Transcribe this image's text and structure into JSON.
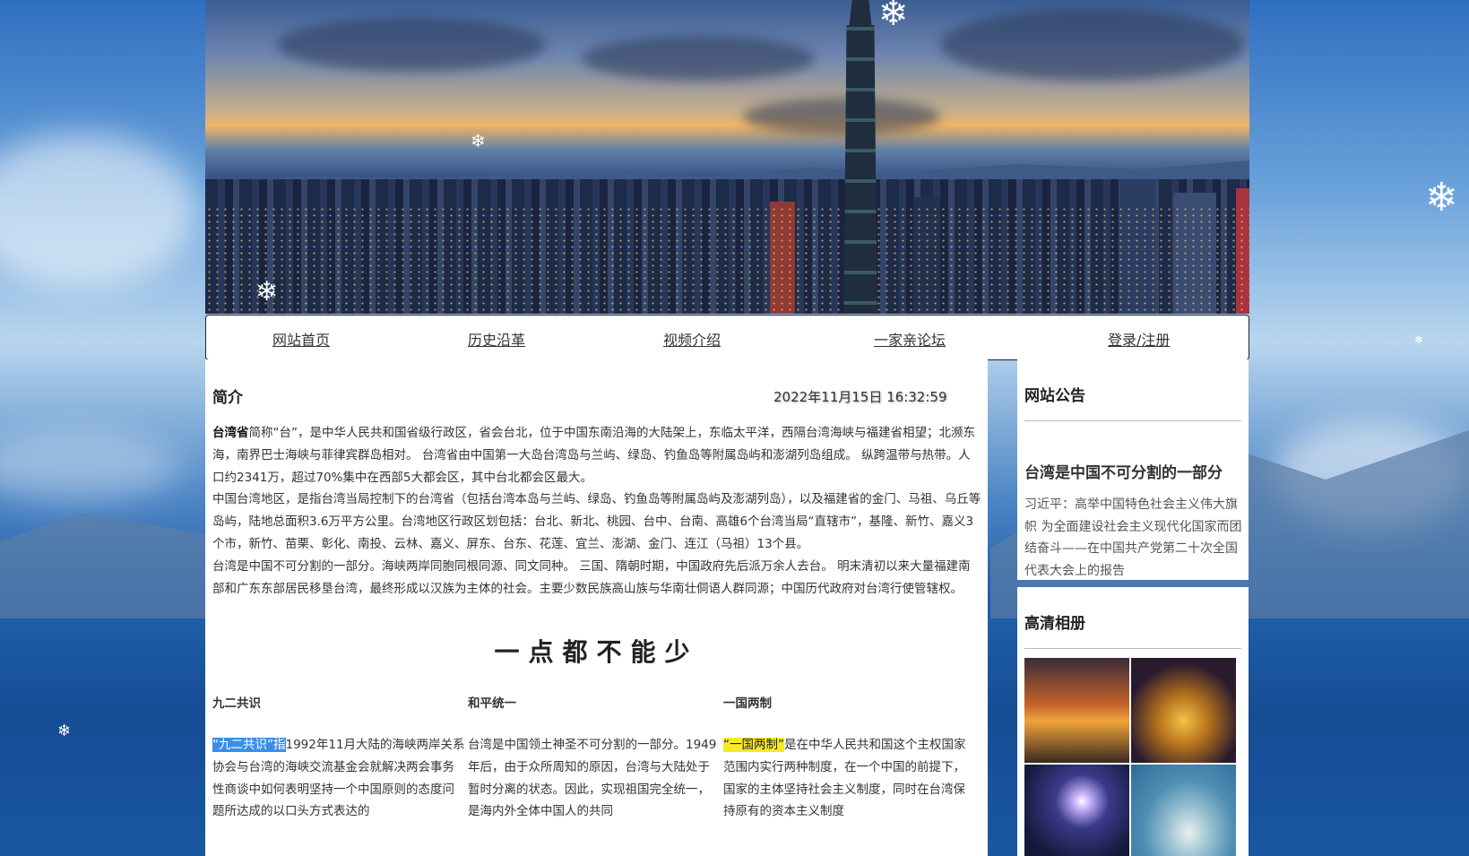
{
  "nav": {
    "home": "网站首页",
    "history": "历史沿革",
    "video": "视频介绍",
    "forum": "一家亲论坛",
    "login": "登录/注册"
  },
  "main": {
    "section_title": "简介",
    "datetime": "2022年11月15日 16:32:59",
    "intro": {
      "p1_bold": "台湾省",
      "p1_text": "简称“台”，是中华人民共和国省级行政区，省会台北，位于中国东南沿海的大陆架上，东临太平洋，西隔台湾海峡与福建省相望；北濒东海，南界巴士海峡与菲律宾群岛相对。 台湾省由中国第一大岛台湾岛与兰屿、绿岛、钓鱼岛等附属岛屿和澎湖列岛组成。 纵跨温带与热带。人口约2341万，超过70%集中在西部5大都会区，其中台北都会区最大。",
      "p2": "中国台湾地区，是指台湾当局控制下的台湾省（包括台湾本岛与兰屿、绿岛、钓鱼岛等附属岛屿及澎湖列岛），以及福建省的金门、马祖、乌丘等岛屿，陆地总面积3.6万平方公里。台湾地区行政区划包括：台北、新北、桃园、台中、台南、高雄6个台湾当局“直辖市”，基隆、新竹、嘉义3个市，新竹、苗栗、彰化、南投、云林、嘉义、屏东、台东、花莲、宜兰、澎湖、金门、连江（马祖）13个县。",
      "p3": "台湾是中国不可分割的一部分。海峡两岸同胞同根同源、同文同种。 三国、隋朝时期，中国政府先后派万余人去台。 明末清初以来大量福建南部和广东东部居民移垦台湾，最终形成以汉族为主体的社会。主要少数民族高山族与华南壮侗语人群同源；中国历代政府对台湾行使管辖权。"
    },
    "slogan": "一点都不能少",
    "columns": [
      {
        "title": "九二共识",
        "highlight": "“九二共识”指",
        "text": "1992年11月大陆的海峡两岸关系协会与台湾的海峡交流基金会就解决两会事务性商谈中如何表明坚持一个中国原则的态度问题所达成的以口头方式表达的"
      },
      {
        "title": "和平统一",
        "highlight": "",
        "text": "台湾是中国领土神圣不可分割的一部分。1949年后，由于众所周知的原因，台湾与大陆处于暂时分离的状态。因此，实现祖国完全统一，是海内外全体中国人的共同"
      },
      {
        "title": "一国两制",
        "highlight": "“一国两制”",
        "text": "是在中华人民共和国这个主权国家范围内实行两种制度，在一个中国的前提下，国家的主体坚持社会主义制度，同时在台湾保持原有的资本主义制度"
      }
    ]
  },
  "sidebar": {
    "notice": {
      "heading": "网站公告",
      "title": "台湾是中国不可分割的一部分",
      "body": "习近平：高举中国特色社会主义伟大旗帜 为全面建设社会主义现代化国家而团结奋斗——在中国共产党第二十次全国代表大会上的报告"
    },
    "album": {
      "heading": "高清相册"
    }
  },
  "colors": {
    "highlight_blue": "#3a8ee8",
    "highlight_yellow": "#f7ea2a",
    "page_bg": "#2f6fc0"
  },
  "icons": [
    "snowflake-icon"
  ]
}
